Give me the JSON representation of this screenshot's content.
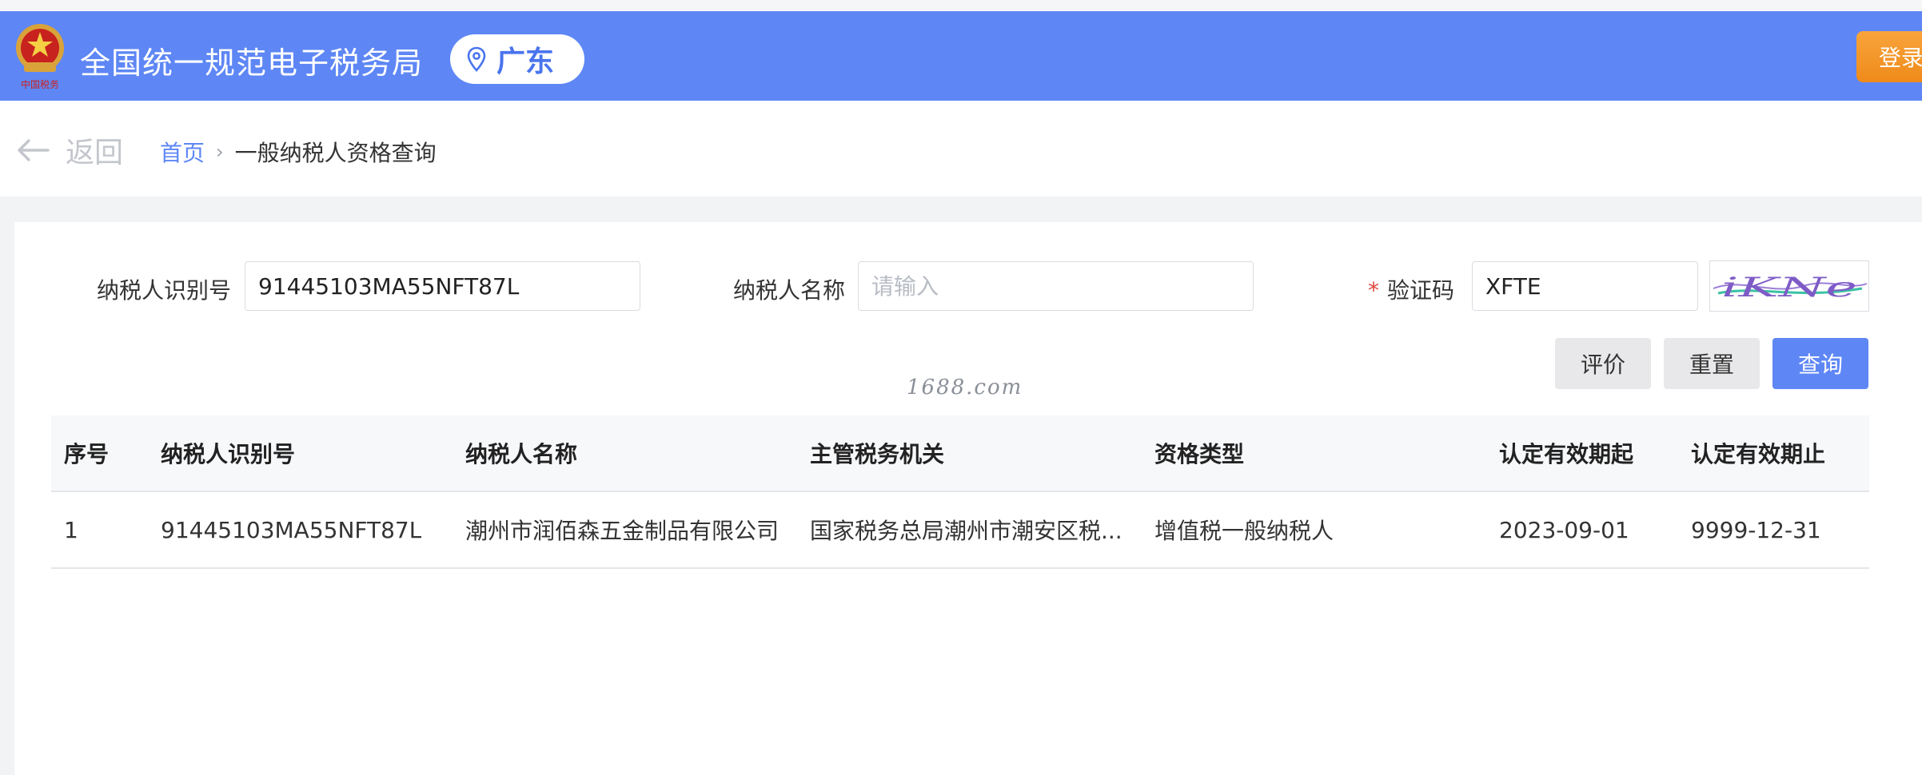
{
  "header": {
    "site_title": "全国统一规范电子税务局",
    "region": "广东",
    "login_label": "登录",
    "emblem_caption": "中国税务"
  },
  "nav": {
    "back_label": "返回",
    "breadcrumb_home": "首页",
    "breadcrumb_sep": "›",
    "breadcrumb_current": "一般纳税人资格查询"
  },
  "form": {
    "taxpayer_id_label": "纳税人识别号",
    "taxpayer_id_value": "91445103MA55NFT87L",
    "taxpayer_name_label": "纳税人名称",
    "taxpayer_name_placeholder": "请输入",
    "captcha_label": "验证码",
    "captcha_required_mark": "*",
    "captcha_value": "XFTE",
    "captcha_image_text": "iKNe"
  },
  "buttons": {
    "rate": "评价",
    "reset": "重置",
    "query": "查询"
  },
  "watermark": "1688.com",
  "table": {
    "headers": [
      "序号",
      "纳税人识别号",
      "纳税人名称",
      "主管税务机关",
      "资格类型",
      "认定有效期起",
      "认定有效期止"
    ],
    "rows": [
      [
        "1",
        "91445103MA55NFT87L",
        "潮州市润佰森五金制品有限公司",
        "国家税务总局潮州市潮安区税...",
        "增值税一般纳税人",
        "2023-09-01",
        "9999-12-31"
      ]
    ]
  },
  "colors": {
    "header_bg": "#5e87f5",
    "primary": "#5e87f5",
    "login_bg": "#f09520",
    "required": "#e0463c"
  },
  "icons": {
    "back": "arrow-left-icon",
    "region": "location-pin-icon",
    "emblem": "tax-emblem-icon"
  }
}
